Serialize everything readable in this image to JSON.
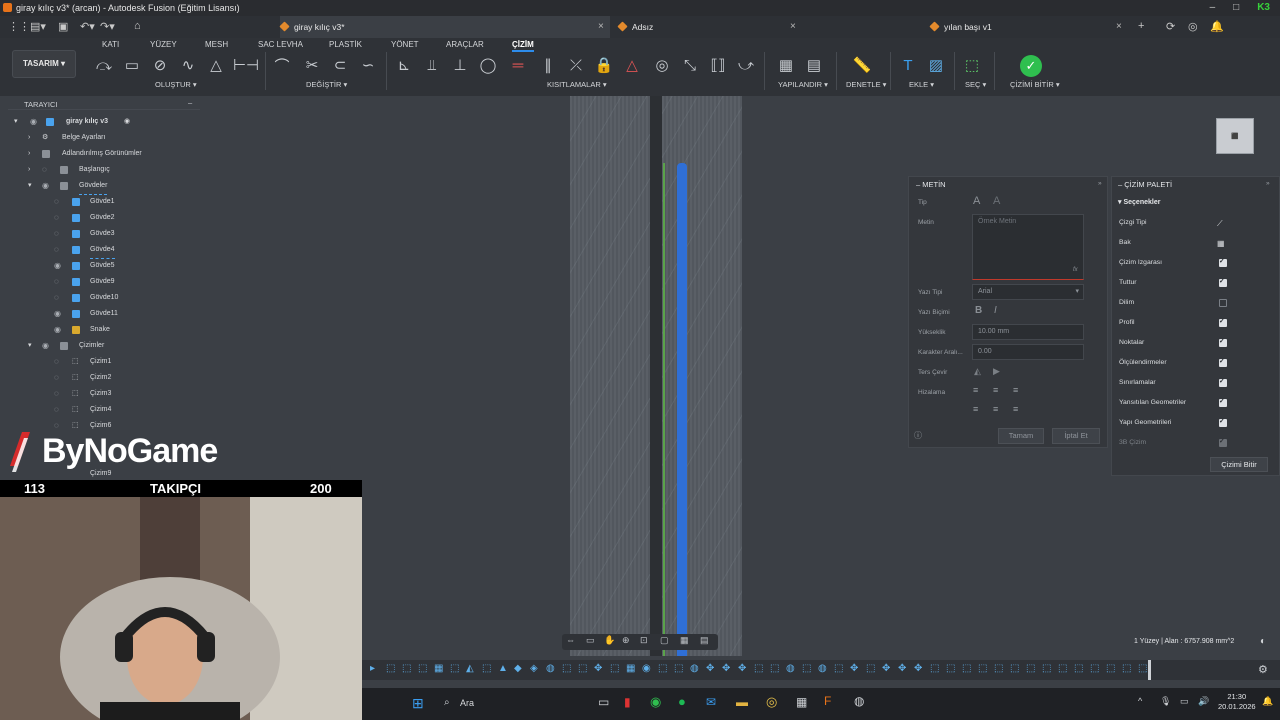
{
  "window": {
    "title": "giray kılıç v3* (arcan) - Autodesk Fusion (Eğitim Lisansı)"
  },
  "tabs": [
    {
      "label": "giray kılıç v3*",
      "active": true
    },
    {
      "label": "Adsız",
      "active": false
    },
    {
      "label": "yılan başı v1",
      "active": false
    }
  ],
  "ribbon": {
    "workspace": "TASARIM",
    "tabs": [
      "KATI",
      "YÜZEY",
      "MESH",
      "SAC LEVHA",
      "PLASTİK",
      "YÖNET",
      "ARAÇLAR",
      "ÇİZİM"
    ],
    "active_tab": "ÇİZİM",
    "groups": {
      "create": "OLUŞTUR",
      "modify": "DEĞİŞTİR",
      "constraints": "KISITLAMALAR",
      "configure": "YAPILANDIR",
      "inspect": "DENETLE",
      "insert": "EKLE",
      "select": "SEÇ",
      "finish": "ÇİZİMİ BİTİR"
    }
  },
  "browser": {
    "title": "TARAYICI",
    "root": "giray kılıç v3",
    "items": [
      {
        "label": "Belge Ayarları",
        "type": "settings"
      },
      {
        "label": "Adlandırılmış Görünümler",
        "type": "folder"
      },
      {
        "label": "Başlangıç",
        "type": "folder"
      },
      {
        "label": "Gövdeler",
        "type": "folder"
      }
    ],
    "bodies": [
      "Gövde1",
      "Gövde2",
      "Gövde3",
      "Gövde4",
      "Gövde5",
      "Gövde9",
      "Gövde10",
      "Gövde11",
      "Snake"
    ],
    "sketch_folder": "Çizimler",
    "sketches": [
      "Çizim1",
      "Çizim2",
      "Çizim3",
      "Çizim4",
      "Çizim6",
      "Çizim9"
    ]
  },
  "text_panel": {
    "title": "METİN",
    "labels": {
      "type": "Tip",
      "text": "Metin",
      "font": "Yazı Tipi",
      "style": "Yazı Biçimi",
      "height": "Yükseklik",
      "char_spacing": "Karakter Aralı...",
      "flip": "Ters Çevir",
      "align": "Hizalama"
    },
    "text_placeholder": "Örnek Metin",
    "font_value": "Arial",
    "height_value": "10.00 mm",
    "spacing_value": "0.00",
    "ok": "Tamam",
    "cancel": "İptal Et"
  },
  "sketch_palette": {
    "title": "ÇİZİM PALETİ",
    "section": "Seçenekler",
    "options": [
      {
        "label": "Çizgi Tipi",
        "state": "icon"
      },
      {
        "label": "Bak",
        "state": "icon"
      },
      {
        "label": "Çizim Izgarası",
        "state": "on"
      },
      {
        "label": "Tuttur",
        "state": "on"
      },
      {
        "label": "Dilim",
        "state": "off"
      },
      {
        "label": "Profil",
        "state": "on"
      },
      {
        "label": "Noktalar",
        "state": "on"
      },
      {
        "label": "Ölçülendirmeler",
        "state": "on"
      },
      {
        "label": "Sınırlamalar",
        "state": "on"
      },
      {
        "label": "Yansıtılan Geometriler",
        "state": "on"
      },
      {
        "label": "Yapı Geometrileri",
        "state": "on"
      },
      {
        "label": "3B Çizim",
        "state": "disabled"
      }
    ],
    "finish": "Çizimi Bitir"
  },
  "status": {
    "selection": "1 Yüzey | Alan : 6757.908 mm^2"
  },
  "overlay": {
    "logo": "ByNoGame",
    "follower_current": "113",
    "follower_label": "TAKIPÇI",
    "follower_goal": "200"
  },
  "taskbar": {
    "search": "Ara",
    "time": "21:30",
    "date": "20.01.2026"
  },
  "colors": {
    "accent": "#2d8ceb",
    "brand": "#e8731a",
    "finish_green": "#2fbf4f"
  }
}
